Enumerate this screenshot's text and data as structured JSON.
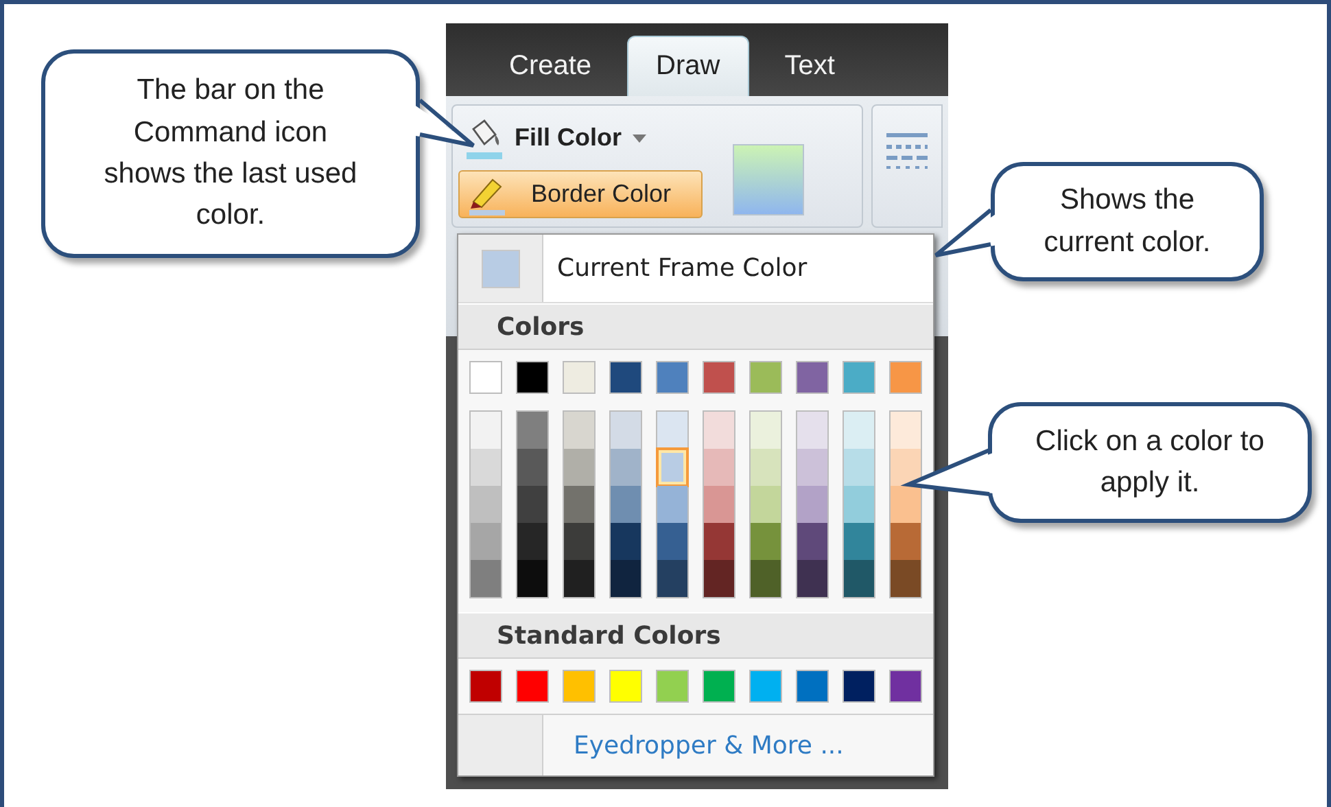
{
  "tabs": [
    {
      "label": "Create",
      "selected": false
    },
    {
      "label": "Draw",
      "selected": true
    },
    {
      "label": "Text",
      "selected": false
    }
  ],
  "ribbon": {
    "buttons": [
      {
        "label": "Fill Color",
        "kind": "dropdown",
        "active": false
      },
      {
        "label": "Border Color",
        "kind": "plain",
        "active": true
      }
    ]
  },
  "menu": {
    "current": {
      "label": "Current Frame Color"
    },
    "colors_header": "Colors",
    "theme_colors": [
      {
        "color": "#ffffff",
        "selected": false
      },
      {
        "color": "#000000",
        "selected": false
      },
      {
        "color": "#eeece1",
        "selected": false
      },
      {
        "color": "#1f497d",
        "selected": false
      },
      {
        "color": "#4f81bd",
        "selected": false
      },
      {
        "color": "#c0504d",
        "selected": false
      },
      {
        "color": "#9bbb59",
        "selected": false
      },
      {
        "color": "#8064a2",
        "selected": false
      },
      {
        "color": "#4bacc6",
        "selected": false
      },
      {
        "color": "#f79646",
        "selected": false
      }
    ],
    "shade_columns": [
      {
        "shades": [
          {
            "color": "#f2f2f2",
            "selected": false
          },
          {
            "color": "#d9d9d9",
            "selected": false
          },
          {
            "color": "#bfbfbf",
            "selected": false
          },
          {
            "color": "#a6a6a6",
            "selected": false
          },
          {
            "color": "#7f7f7f",
            "selected": false
          }
        ]
      },
      {
        "shades": [
          {
            "color": "#7f7f7f",
            "selected": false
          },
          {
            "color": "#595959",
            "selected": false
          },
          {
            "color": "#404040",
            "selected": false
          },
          {
            "color": "#262626",
            "selected": false
          },
          {
            "color": "#0d0d0d",
            "selected": false
          }
        ]
      },
      {
        "shades": [
          {
            "color": "#d8d6cf",
            "selected": false
          },
          {
            "color": "#b0afa8",
            "selected": false
          },
          {
            "color": "#73726c",
            "selected": false
          },
          {
            "color": "#3c3c3a",
            "selected": false
          },
          {
            "color": "#202020",
            "selected": false
          }
        ]
      },
      {
        "shades": [
          {
            "color": "#d3dbe6",
            "selected": false
          },
          {
            "color": "#a0b3c9",
            "selected": false
          },
          {
            "color": "#6f8eb0",
            "selected": false
          },
          {
            "color": "#17375e",
            "selected": false
          },
          {
            "color": "#10243f",
            "selected": false
          }
        ]
      },
      {
        "shades": [
          {
            "color": "#dbe5f1",
            "selected": false
          },
          {
            "color": "#b8cce4",
            "selected": true
          },
          {
            "color": "#95b3d7",
            "selected": false
          },
          {
            "color": "#366092",
            "selected": false
          },
          {
            "color": "#244061",
            "selected": false
          }
        ]
      },
      {
        "shades": [
          {
            "color": "#f2dcdb",
            "selected": false
          },
          {
            "color": "#e6b9b8",
            "selected": false
          },
          {
            "color": "#d99694",
            "selected": false
          },
          {
            "color": "#953735",
            "selected": false
          },
          {
            "color": "#632523",
            "selected": false
          }
        ]
      },
      {
        "shades": [
          {
            "color": "#ebf1dd",
            "selected": false
          },
          {
            "color": "#d7e3bc",
            "selected": false
          },
          {
            "color": "#c3d69b",
            "selected": false
          },
          {
            "color": "#76923c",
            "selected": false
          },
          {
            "color": "#4f6128",
            "selected": false
          }
        ]
      },
      {
        "shades": [
          {
            "color": "#e5e0ec",
            "selected": false
          },
          {
            "color": "#ccc1d9",
            "selected": false
          },
          {
            "color": "#b2a2c7",
            "selected": false
          },
          {
            "color": "#5f497a",
            "selected": false
          },
          {
            "color": "#3f3151",
            "selected": false
          }
        ]
      },
      {
        "shades": [
          {
            "color": "#dbeef3",
            "selected": false
          },
          {
            "color": "#b7dde8",
            "selected": false
          },
          {
            "color": "#92cddc",
            "selected": false
          },
          {
            "color": "#31859b",
            "selected": false
          },
          {
            "color": "#205867",
            "selected": false
          }
        ]
      },
      {
        "shades": [
          {
            "color": "#fdeada",
            "selected": false
          },
          {
            "color": "#fbd5b5",
            "selected": false
          },
          {
            "color": "#fac08f",
            "selected": false
          },
          {
            "color": "#b86a36",
            "selected": false
          },
          {
            "color": "#7a4a25",
            "selected": false
          }
        ]
      }
    ],
    "standard_header": "Standard Colors",
    "standard_colors": [
      {
        "color": "#c00000",
        "selected": false
      },
      {
        "color": "#ff0000",
        "selected": false
      },
      {
        "color": "#ffc000",
        "selected": false
      },
      {
        "color": "#ffff00",
        "selected": false
      },
      {
        "color": "#92d050",
        "selected": false
      },
      {
        "color": "#00b050",
        "selected": false
      },
      {
        "color": "#00b0f0",
        "selected": false
      },
      {
        "color": "#0070c0",
        "selected": false
      },
      {
        "color": "#002060",
        "selected": false
      },
      {
        "color": "#7030a0",
        "selected": false
      }
    ],
    "more": "Eyedropper & More ..."
  },
  "callouts": [
    {
      "text": "The bar on the Command icon shows the last used color."
    },
    {
      "text": "Shows the current color."
    },
    {
      "text": "Click on a color to apply it."
    }
  ]
}
